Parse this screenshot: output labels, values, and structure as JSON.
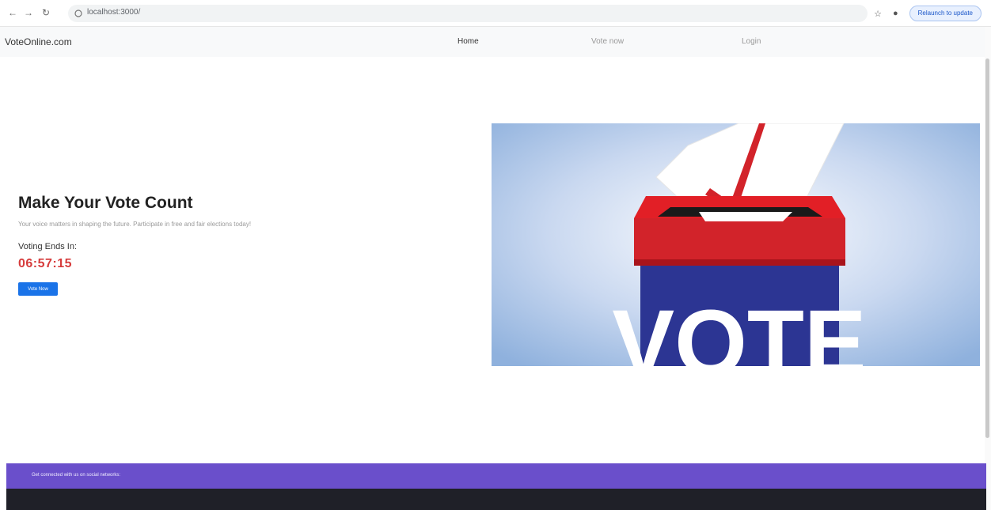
{
  "browser": {
    "back_icon": "arrow-left-icon",
    "forward_icon": "arrow-right-icon",
    "reload_icon": "reload-icon",
    "url": "localhost:3000/",
    "update_button": "Relaunch to update"
  },
  "nav": {
    "brand": "VoteOnline.com",
    "links": [
      "Home",
      "Vote now",
      "Login"
    ]
  },
  "hero": {
    "title": "Make Your Vote Count",
    "subtitle": "Your voice matters in shaping the future. Participate in free and fair elections today!",
    "timer_label": "Voting Ends In:",
    "timer_value": "06:57:15",
    "cta": "Vote Now",
    "image_word": "VOTE"
  },
  "footer": {
    "social_text": "Get connected with us on social networks:"
  },
  "colors": {
    "accent": "#1a73e8",
    "timer": "#d63c3c",
    "footer_purple": "#6a4fcb",
    "footer_dark": "#1f2028",
    "ballot_red": "#d2232a",
    "ballot_blue": "#2c3593"
  }
}
